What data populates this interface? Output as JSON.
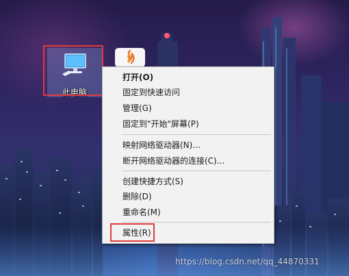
{
  "desktop": {
    "icons": [
      {
        "label": "此电脑",
        "icon": "computer-monitor-icon"
      },
      {
        "label": "",
        "icon": "app-flame-icon"
      }
    ]
  },
  "context_menu": {
    "groups": [
      [
        "打开(O)",
        "固定到快速访问",
        "管理(G)",
        "固定到\"开始\"屏幕(P)"
      ],
      [
        "映射网络驱动器(N)...",
        "断开网络驱动器的连接(C)..."
      ],
      [
        "创建快捷方式(S)",
        "删除(D)",
        "重命名(M)"
      ],
      [
        "属性(R)"
      ]
    ],
    "open": "打开(O)",
    "pin_quick_access": "固定到快速访问",
    "manage": "管理(G)",
    "pin_start": "固定到\"开始\"屏幕(P)",
    "map_drive": "映射网络驱动器(N)...",
    "disconnect_drive": "断开网络驱动器的连接(C)...",
    "create_shortcut": "创建快捷方式(S)",
    "delete": "删除(D)",
    "rename": "重命名(M)",
    "properties": "属性(R)"
  },
  "watermark": "https://blog.csdn.net/qq_44870331",
  "colors": {
    "highlight_box": "#e23b3b",
    "menu_background": "#f2f2f2",
    "icon_selection": "#7896d2"
  }
}
